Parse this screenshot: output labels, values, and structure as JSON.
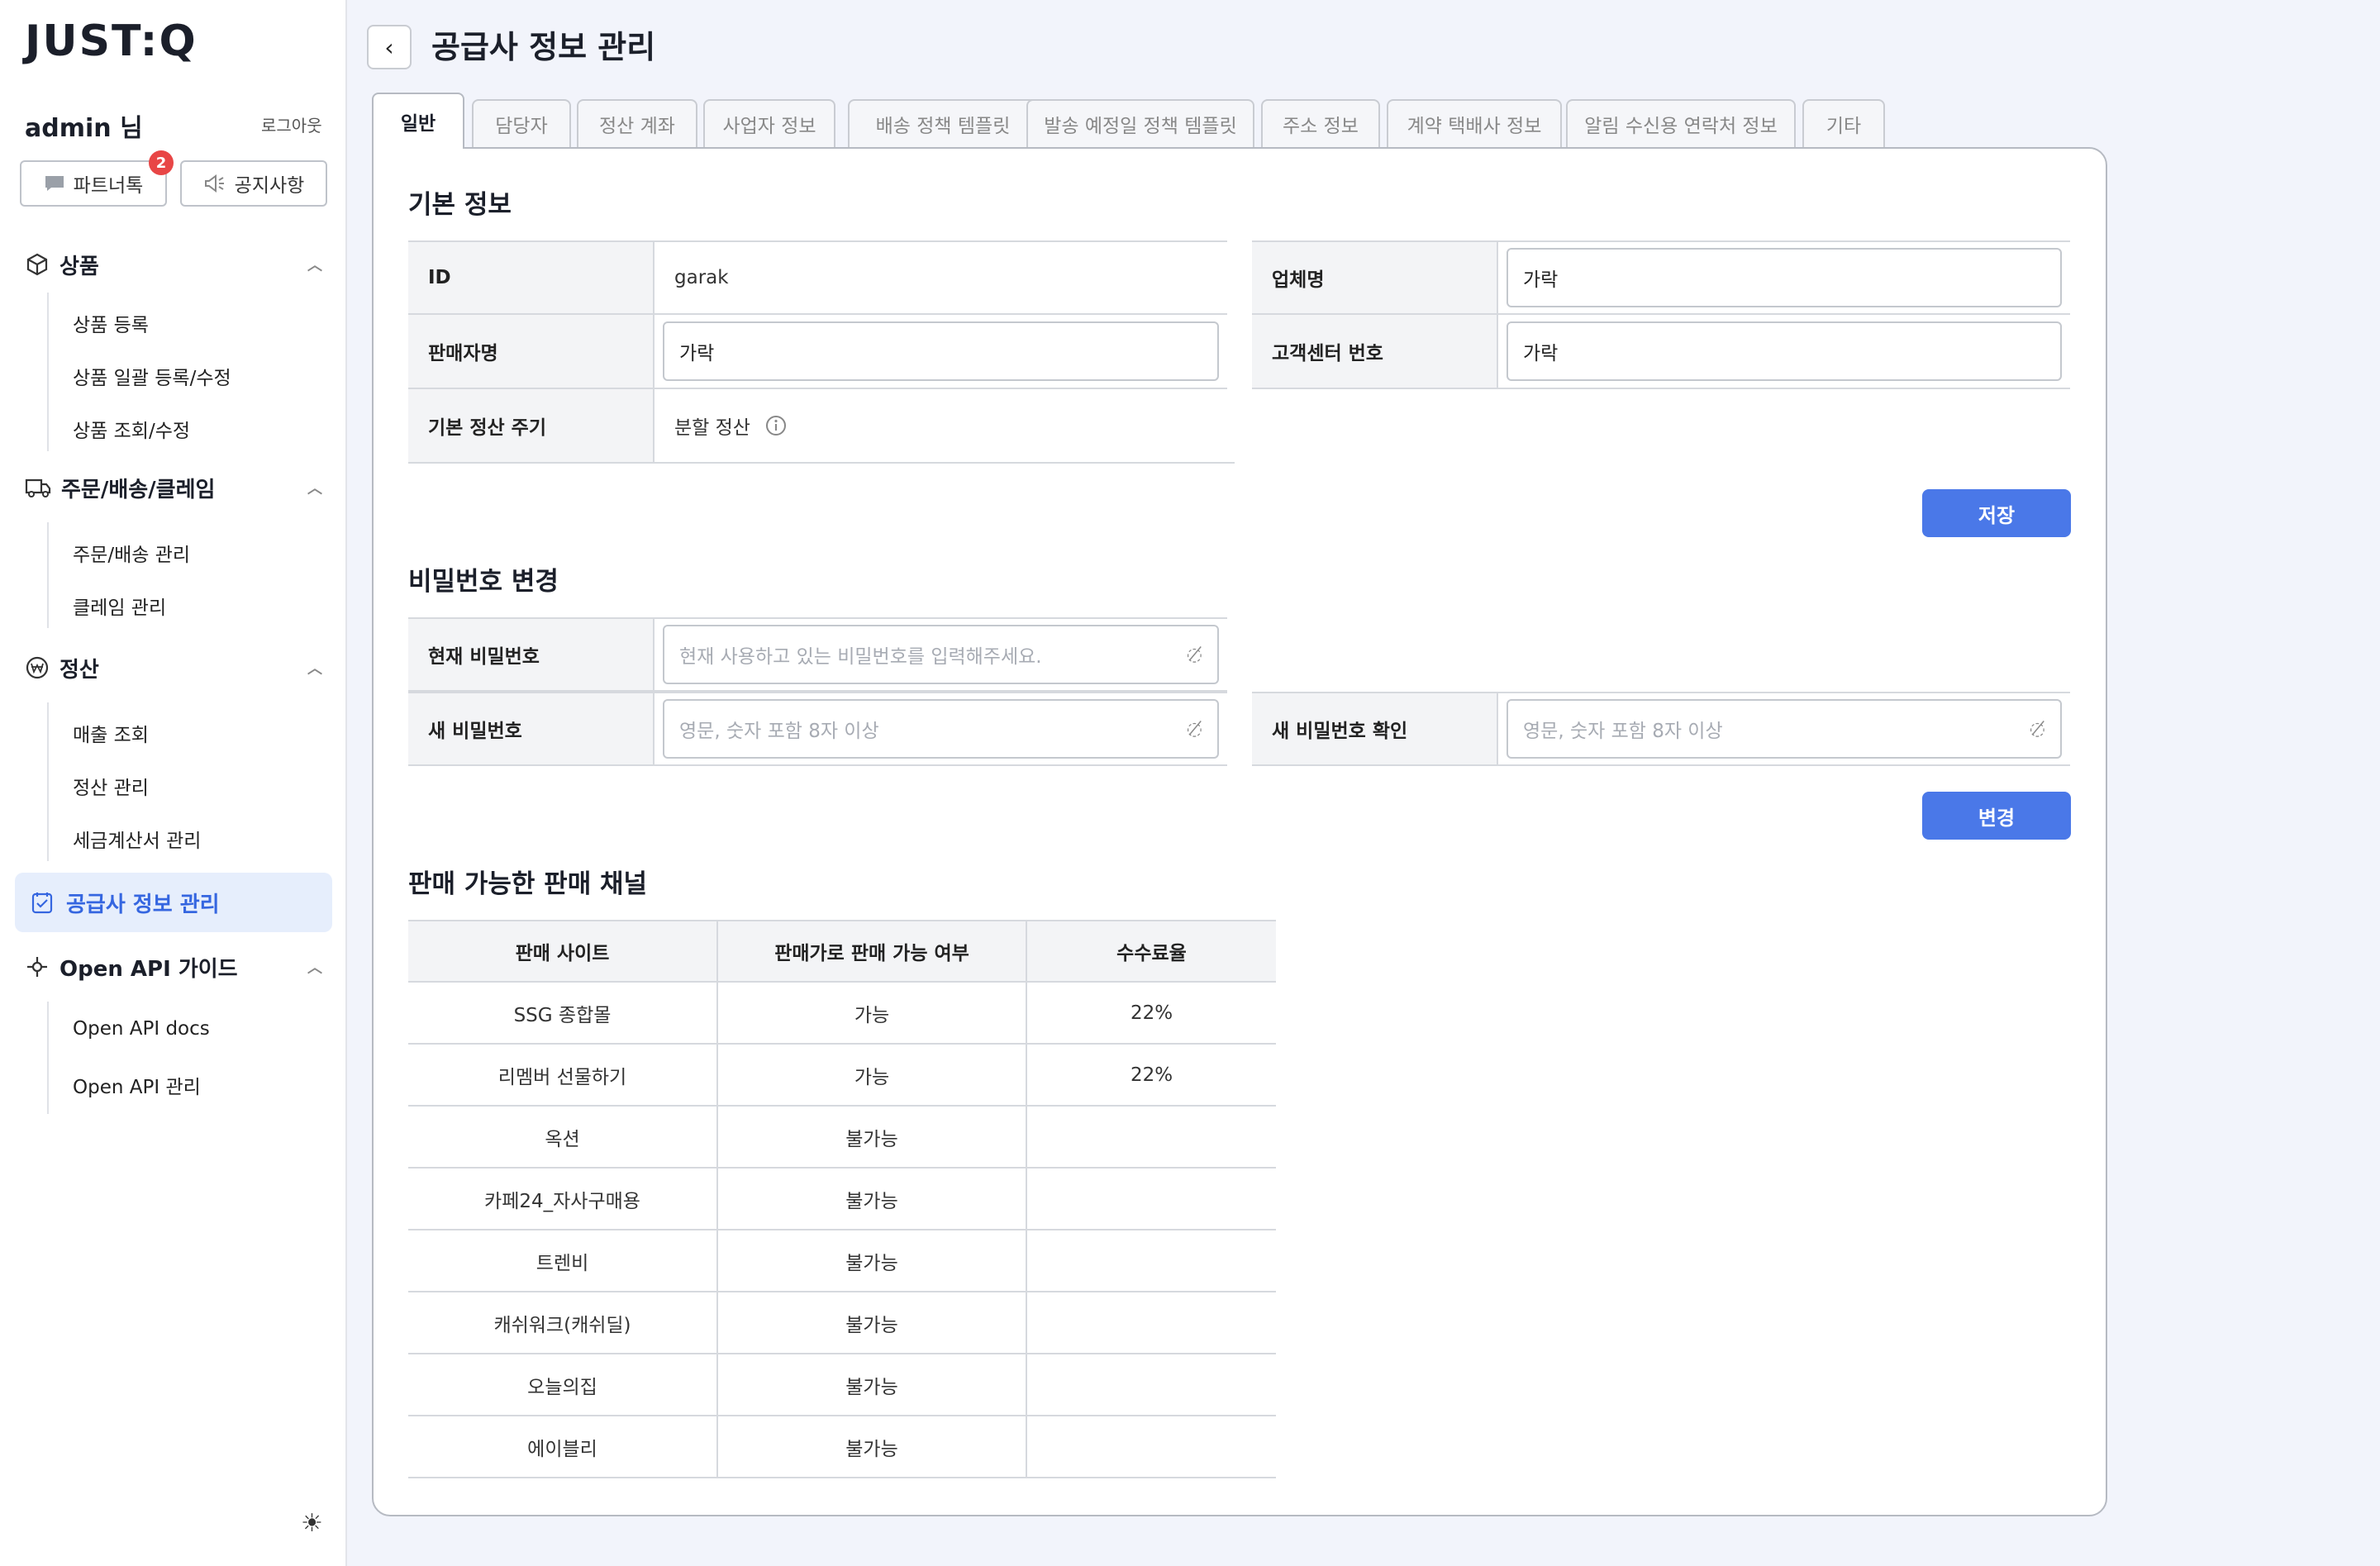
{
  "sidebar": {
    "logo": "JUST:Q",
    "user": "admin 님",
    "logout": "로그아웃",
    "partner_btn": "파트너톡",
    "partner_badge": "2",
    "notice_btn": "공지사항",
    "groups": [
      {
        "label": "상품",
        "icon": "box-icon",
        "items": [
          "상품 등록",
          "상품 일괄 등록/수정",
          "상품 조회/수정"
        ]
      },
      {
        "label": "주문/배송/클레임",
        "icon": "truck-icon",
        "items": [
          "주문/배송 관리",
          "클레임 관리"
        ]
      },
      {
        "label": "정산",
        "icon": "won-icon",
        "items": [
          "매출 조회",
          "정산 관리",
          "세금계산서 관리"
        ]
      },
      {
        "label": "공급사 정보 관리",
        "icon": "supplier-icon",
        "items": []
      },
      {
        "label": "Open API 가이드",
        "icon": "api-icon",
        "items": [
          "Open API docs",
          "Open API 관리"
        ]
      }
    ]
  },
  "header": {
    "title": "공급사 정보 관리"
  },
  "tabs": [
    "일반",
    "담당자",
    "정산 계좌",
    "사업자 정보",
    "배송 정책 템플릿",
    "발송 예정일 정책 템플릿",
    "주소 정보",
    "계약 택배사 정보",
    "알림 수신용 연락처 정보",
    "기타"
  ],
  "basic": {
    "title": "기본 정보",
    "id_label": "ID",
    "id_value": "garak",
    "company_label": "업체명",
    "company_value": "가락",
    "seller_label": "판매자명",
    "seller_value": "가락",
    "cs_label": "고객센터 번호",
    "cs_value": "가락",
    "cycle_label": "기본 정산 주기",
    "cycle_value": "분할 정산",
    "save": "저장"
  },
  "password": {
    "title": "비밀번호 변경",
    "current_label": "현재 비밀번호",
    "current_placeholder": "현재 사용하고 있는 비밀번호를 입력해주세요.",
    "new_label": "새 비밀번호",
    "new_placeholder": "영문, 숫자 포함 8자 이상",
    "confirm_label": "새 비밀번호 확인",
    "confirm_placeholder": "영문, 숫자 포함 8자 이상",
    "change": "변경"
  },
  "channels": {
    "title": "판매 가능한 판매 채널",
    "headers": [
      "판매 사이트",
      "판매가로 판매 가능 여부",
      "수수료율"
    ],
    "rows": [
      [
        "SSG 종합몰",
        "가능",
        "22%"
      ],
      [
        "리멤버 선물하기",
        "가능",
        "22%"
      ],
      [
        "옥션",
        "불가능",
        ""
      ],
      [
        "카페24_자사구매용",
        "불가능",
        ""
      ],
      [
        "트렌비",
        "불가능",
        ""
      ],
      [
        "캐쉬워크(캐쉬딜)",
        "불가능",
        ""
      ],
      [
        "오늘의집",
        "불가능",
        ""
      ],
      [
        "에이블리",
        "불가능",
        ""
      ]
    ]
  }
}
